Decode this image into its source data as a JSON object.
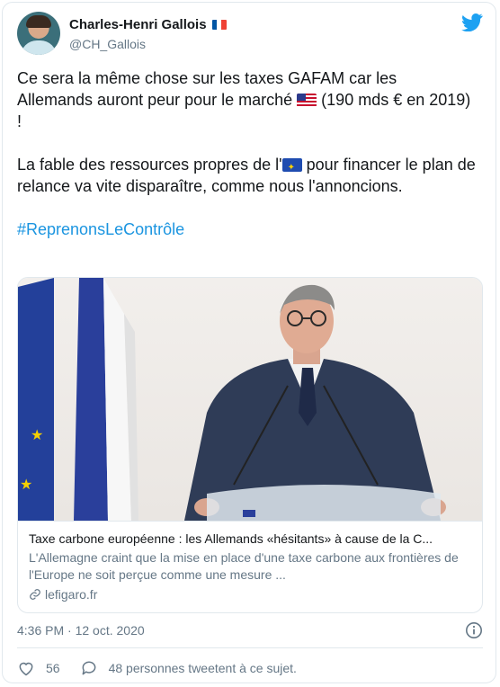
{
  "author": {
    "name": "Charles-Henri Gallois",
    "handle": "@CH_Gallois"
  },
  "tweet": {
    "line1_before_flag": "Ce sera la même chose sur les taxes GAFAM car les Allemands auront peur pour le marché ",
    "line1_after_flag": " (190 mds € en 2019) !",
    "line2_before_flag": "La fable des ressources propres de l'",
    "line2_after_flag": " pour financer le plan de relance va vite disparaître, comme nous l'annoncions.",
    "hashtag": "#ReprenonsLeContrôle"
  },
  "link_card": {
    "title": "Taxe carbone européenne : les Allemands «hésitants» à cause de la C...",
    "description": "L'Allemagne craint que la mise en place d'une taxe carbone aux frontières de l'Europe ne soit perçue comme une mesure ...",
    "domain": "lefigaro.fr"
  },
  "timestamp": "4:36 PM · 12 oct. 2020",
  "actions": {
    "likes": "56",
    "replies_label": "48 personnes tweetent à ce sujet."
  },
  "colors": {
    "twitter_blue": "#1da1f2",
    "hashtag": "#1b95e0",
    "secondary_text": "#657786",
    "border": "#e1e8ed"
  },
  "icons": [
    "twitter-bird-icon",
    "french-flag-icon",
    "us-flag-icon",
    "eu-flag-icon",
    "link-icon",
    "info-icon",
    "heart-icon",
    "reply-bubble-icon"
  ]
}
